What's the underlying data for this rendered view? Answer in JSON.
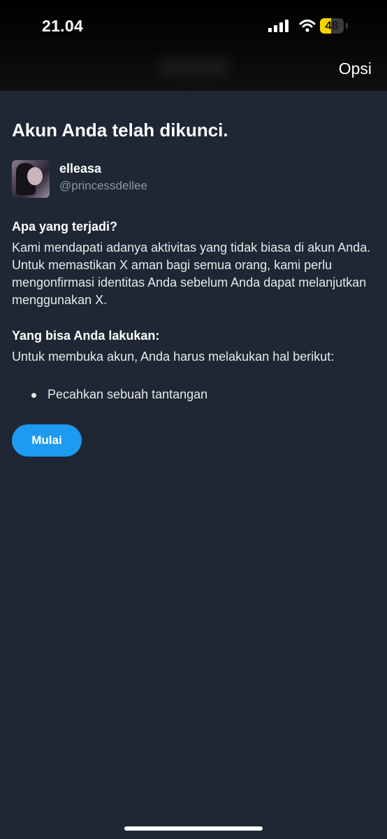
{
  "status_bar": {
    "time": "21.04",
    "battery_level": "48",
    "battery_color": "#f5d400",
    "icons": [
      "signal-icon",
      "wifi-icon",
      "battery-icon"
    ]
  },
  "header": {
    "options_label": "Opsi"
  },
  "page": {
    "title": "Akun Anda telah dikunci.",
    "background": "#1e2733"
  },
  "account": {
    "display_name": "elleasa",
    "handle": "@princessdellee"
  },
  "what_happened": {
    "heading": "Apa yang terjadi?",
    "body": "Kami mendapati adanya aktivitas yang tidak biasa di akun Anda. Untuk memastikan X aman bagi semua orang, kami perlu mengonfirmasi identitas Anda sebelum Anda dapat melanjutkan menggunakan X."
  },
  "what_you_can_do": {
    "heading": "Yang bisa Anda lakukan:",
    "body": "Untuk membuka akun, Anda harus melakukan hal berikut:",
    "steps": [
      "Pecahkan sebuah tantangan"
    ]
  },
  "actions": {
    "start_label": "Mulai",
    "accent": "#1d9bf0"
  }
}
